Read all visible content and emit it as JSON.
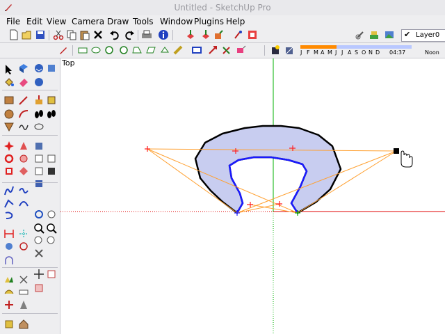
{
  "window": {
    "title": "Untitled - SketchUp Pro"
  },
  "menu": [
    "File",
    "Edit",
    "View",
    "Camera",
    "Draw",
    "Tools",
    "Window",
    "Plugins",
    "Help"
  ],
  "layer": {
    "name": "Layer0",
    "checked": true
  },
  "shadow": {
    "months": [
      "J",
      "F",
      "M",
      "A",
      "M",
      "J",
      "J",
      "A",
      "S",
      "O",
      "N",
      "D"
    ],
    "time": "04:37",
    "noon": "Noon"
  },
  "viewport": {
    "view_name": "Top"
  },
  "colors": {
    "red_axis": "#e00000",
    "green_axis": "#00b000",
    "face_fill": "#c8cdf0",
    "edge": "#000000",
    "selected_edge": "#1a1aff",
    "construction": "#ffa030"
  },
  "icons_toolbar1": [
    "new-icon",
    "open-icon",
    "save-icon",
    "cut-icon",
    "copy-icon",
    "paste-icon",
    "erase-icon",
    "undo-icon",
    "redo-icon",
    "print-icon",
    "model-info-icon",
    "get-models-icon",
    "share-model-icon",
    "share-component-icon",
    "get-photo-texture-icon",
    "preview-icon",
    "add-location-icon",
    "toggle-terrain-icon",
    "photo-textures-icon"
  ],
  "icons_toolbar2": [
    "pencil-icon",
    "select-icon",
    "freehand-icon",
    "arc1-icon",
    "arc2-icon",
    "arc3-icon",
    "polygon-icon",
    "rect-icon",
    "shape1-icon",
    "shape2-icon",
    "shape3-icon",
    "shape4-icon",
    "shape5-icon",
    "shadow-settings-icon",
    "display-shadows-icon"
  ]
}
